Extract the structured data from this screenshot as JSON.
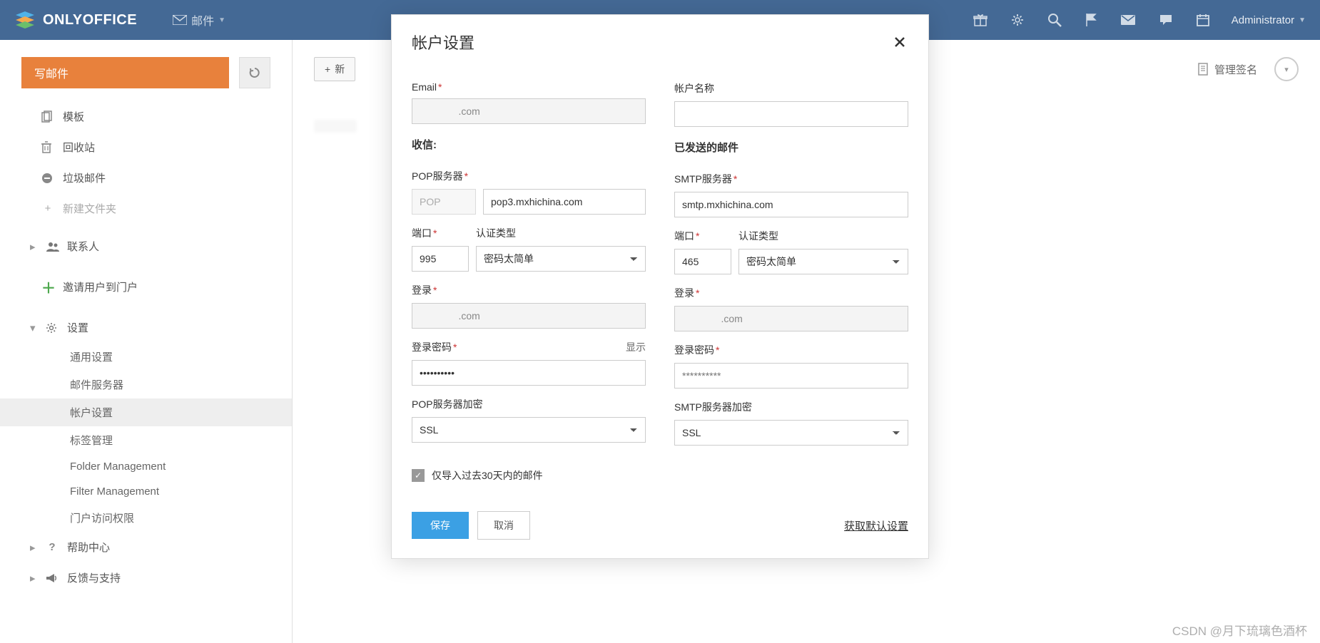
{
  "header": {
    "logo_text": "ONLYOFFICE",
    "module": "邮件",
    "user": "Administrator"
  },
  "sidebar": {
    "compose_label": "写邮件",
    "items": {
      "templates": "模板",
      "trash": "回收站",
      "spam": "垃圾邮件",
      "new_folder": "新建文件夹",
      "contacts": "联系人",
      "invite": "邀请用户到门户",
      "settings": "设置",
      "help": "帮助中心",
      "feedback": "反馈与支持"
    },
    "settings_sub": {
      "general": "通用设置",
      "mail_server": "邮件服务器",
      "account": "帐户设置",
      "tags": "标签管理",
      "folder_mgmt": "Folder Management",
      "filter_mgmt": "Filter Management",
      "portal_access": "门户访问权限"
    }
  },
  "main": {
    "new_button_prefix": "+",
    "new_button_text": "新",
    "manage_signature": "管理签名"
  },
  "modal": {
    "title": "帐户设置",
    "labels": {
      "email": "Email",
      "account_name": "帐户名称",
      "receive_section": "收信:",
      "sent_section": "已发送的邮件",
      "pop_server": "POP服务器",
      "smtp_server": "SMTP服务器",
      "port": "端口",
      "auth_type": "认证类型",
      "login": "登录",
      "password": "登录密码",
      "pop_encryption": "POP服务器加密",
      "smtp_encryption": "SMTP服务器加密",
      "show": "显示",
      "import_30days": "仅导入过去30天内的邮件",
      "save": "保存",
      "cancel": "取消",
      "get_default": "获取默认设置"
    },
    "values": {
      "email": "              .com",
      "account_name": "",
      "protocol": "POP",
      "pop_server": "pop3.mxhichina.com",
      "smtp_server": "smtp.mxhichina.com",
      "pop_port": "995",
      "smtp_port": "465",
      "pop_auth": "密码太简单",
      "smtp_auth": "密码太简单",
      "pop_login": "              .com",
      "smtp_login": "              .com",
      "pop_password": "••••••••••",
      "smtp_password_placeholder": "**********",
      "pop_encryption": "SSL",
      "smtp_encryption": "SSL",
      "import_30days_checked": true
    }
  },
  "watermark": "CSDN @月下琉璃色酒杯"
}
